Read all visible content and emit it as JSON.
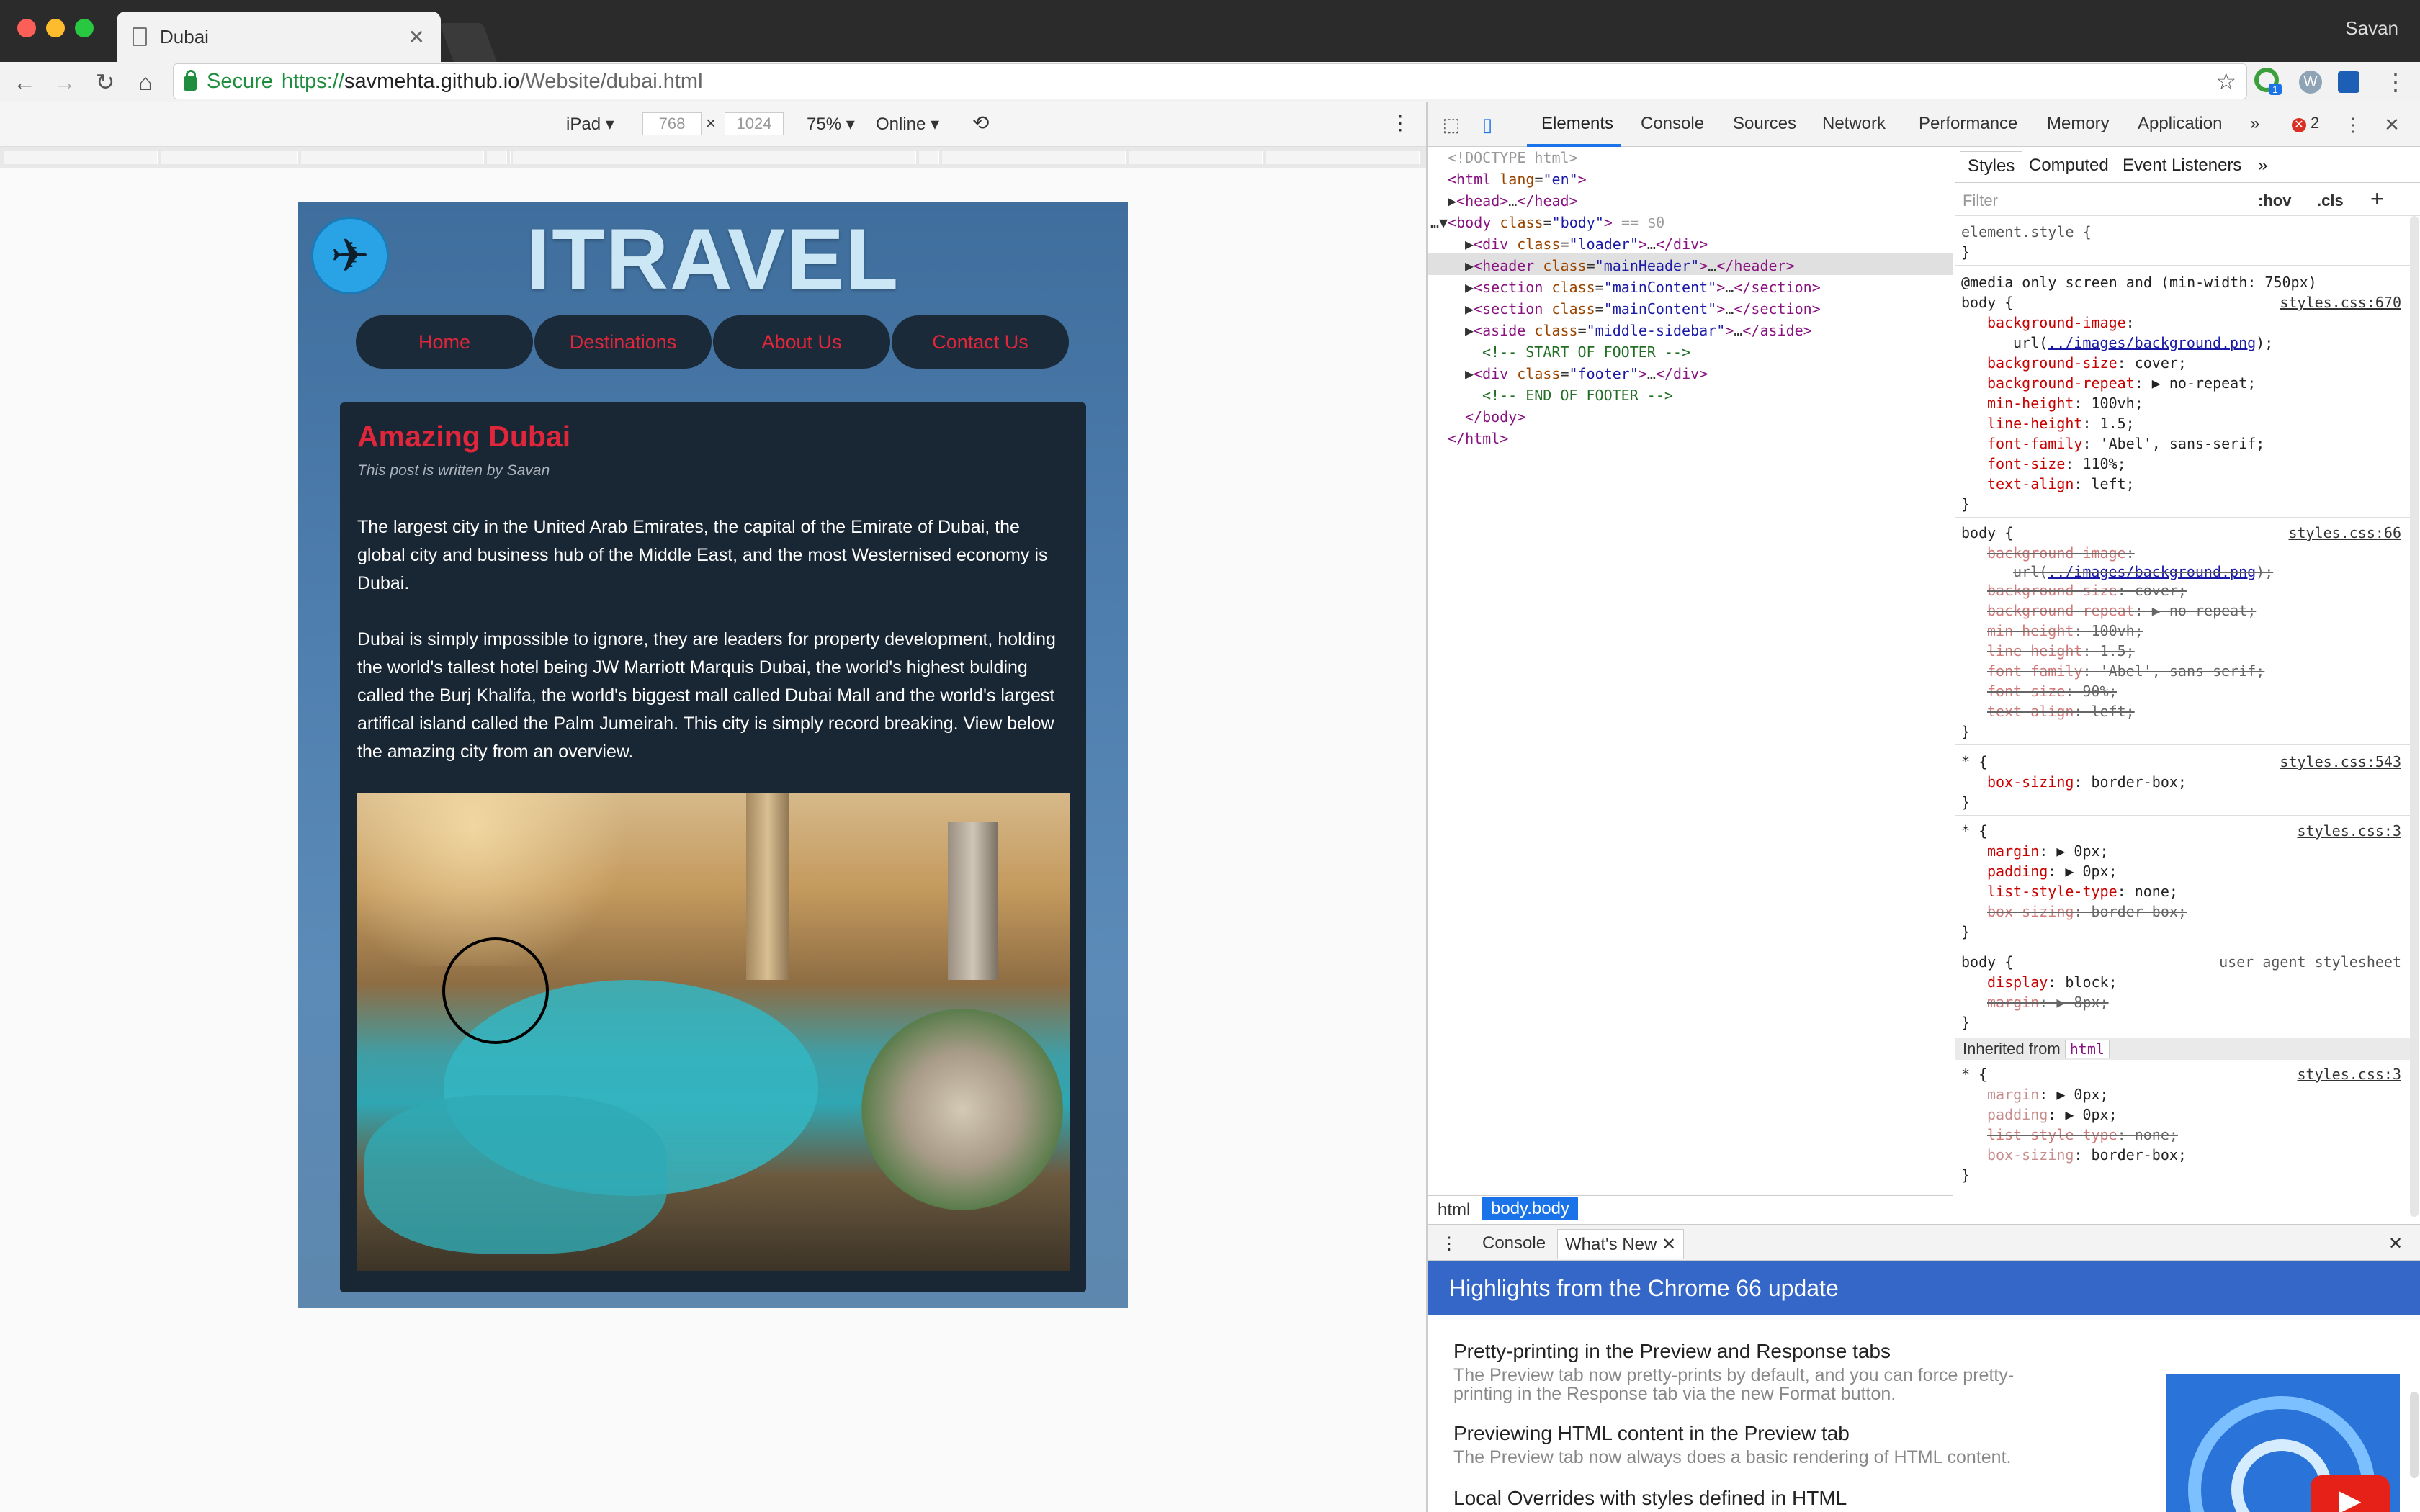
{
  "browser": {
    "tab_title": "Dubai",
    "profile_name": "Savan",
    "url_secure_label": "Secure",
    "url_scheme": "https://",
    "url_host": "savmehta.github.io",
    "url_path": "/Website/dubai.html",
    "extension_badge": "1"
  },
  "device_toolbar": {
    "device": "iPad",
    "width": "768",
    "height": "1024",
    "zoom": "75%",
    "network": "Online"
  },
  "page": {
    "brand": "ITRAVEL",
    "nav": [
      "Home",
      "Destinations",
      "About Us",
      "Contact Us"
    ],
    "post_title": "Amazing Dubai",
    "byline": "This post is written by Savan",
    "paragraph1": "The largest city in the United Arab Emirates, the capital of the Emirate of Dubai, the global city and business hub of the Middle East, and the most Westernised economy is Dubai.",
    "paragraph2": "Dubai is simply impossible to ignore, they are leaders for property development, holding the world's tallest hotel being JW Marriott Marquis Dubai, the world's highest bulding called the Burj Khalifa, the world's biggest mall called Dubai Mall and the world's largest artifical island called the Palm Jumeirah. This city is simply record breaking. View below the amazing city from an overview."
  },
  "devtools": {
    "tabs": [
      "Elements",
      "Console",
      "Sources",
      "Network",
      "Performance",
      "Memory",
      "Application"
    ],
    "error_count": "2",
    "breadcrumbs": [
      "html",
      "body.body"
    ],
    "styles_tabs": [
      "Styles",
      "Computed",
      "Event Listeners"
    ],
    "filter_placeholder": "Filter",
    "hov_label": ":hov",
    "cls_label": ".cls",
    "inherited_label": "Inherited from",
    "inherited_tag": "html",
    "drawer_tabs": [
      "Console",
      "What's New"
    ],
    "whats_new": {
      "banner": "Highlights from the Chrome 66 update",
      "items": [
        {
          "title": "Pretty-printing in the Preview and Response tabs",
          "desc": "The Preview tab now pretty-prints by default, and you can force pretty-printing in the Response tab via the new Format button."
        },
        {
          "title": "Previewing HTML content in the Preview tab",
          "desc": "The Preview tab now always does a basic rendering of HTML content."
        },
        {
          "title": "Local Overrides with styles defined in HTML",
          "desc": ""
        }
      ]
    }
  },
  "colors": {
    "accent_red": "#e0263a",
    "devtools_blue": "#1a73e8",
    "banner_blue": "#3567c9",
    "card_bg": "#192633"
  },
  "icons": [
    "back-icon",
    "forward-icon",
    "reload-icon",
    "home-icon",
    "star-icon",
    "airplane-icon",
    "inspect-icon",
    "device-toggle-icon",
    "rotate-icon",
    "more-icon",
    "close-icon"
  ]
}
